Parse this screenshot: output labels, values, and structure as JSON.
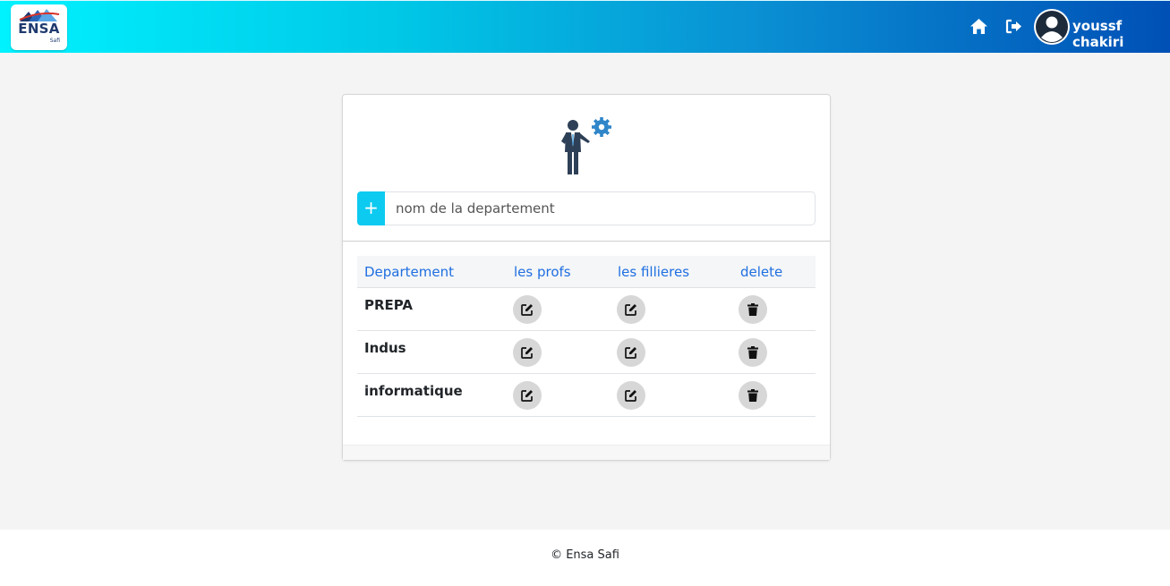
{
  "header": {
    "logo_text": "ENSA",
    "logo_subtext": "Safi",
    "username": "youssf chakiri",
    "icons": [
      "home-icon",
      "logout-icon",
      "user-avatar-icon"
    ]
  },
  "form": {
    "add_label": "+",
    "department_placeholder": "nom de la departement",
    "department_value": ""
  },
  "table": {
    "headers": [
      "Departement",
      "les profs",
      "les fillieres",
      "delete"
    ],
    "rows": [
      {
        "name": "PREPA"
      },
      {
        "name": "Indus"
      },
      {
        "name": "informatique"
      }
    ],
    "row_icons": [
      "edit-icon",
      "edit-icon",
      "trash-icon"
    ]
  },
  "footer": {
    "copyright": "© Ensa Safi"
  },
  "colors": {
    "header_gradient_start": "#00f2ff",
    "header_gradient_end": "#0050b6",
    "add_button": "#0dcaf0",
    "table_header_text": "#1e6fe0",
    "action_button_bg": "#d7d7d7"
  }
}
